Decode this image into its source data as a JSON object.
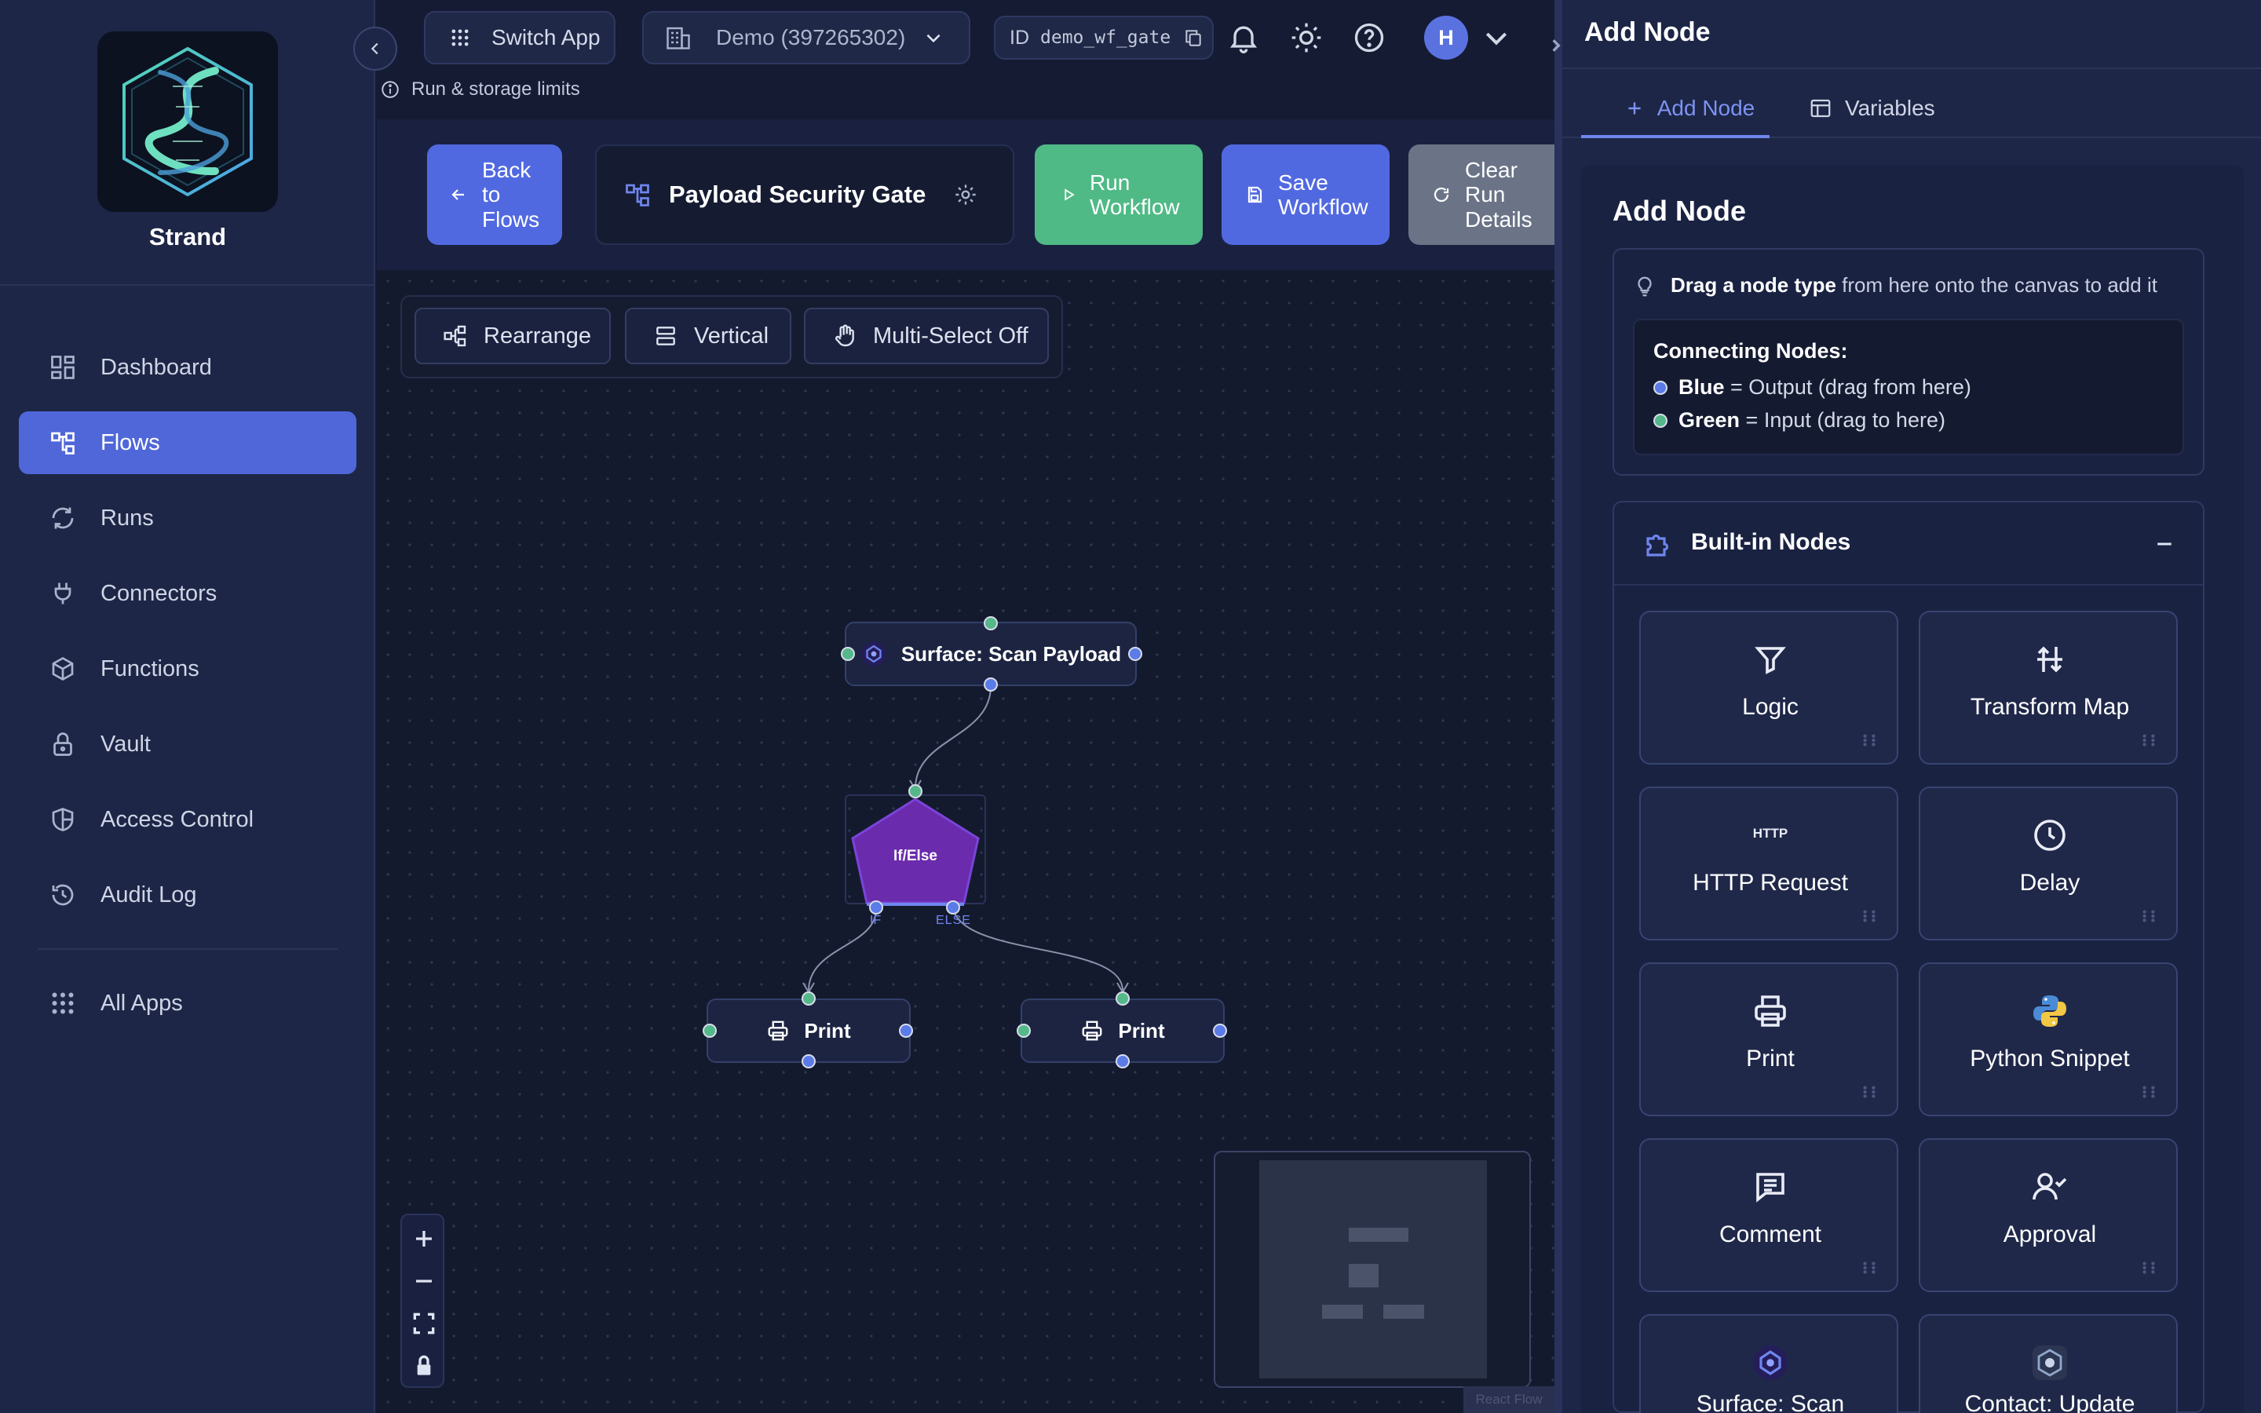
{
  "app": {
    "name": "Strand"
  },
  "sidebar": {
    "items": [
      {
        "label": "Dashboard",
        "icon": "dashboard-icon",
        "active": false
      },
      {
        "label": "Flows",
        "icon": "flows-icon",
        "active": true
      },
      {
        "label": "Runs",
        "icon": "runs-icon",
        "active": false
      },
      {
        "label": "Connectors",
        "icon": "plug-icon",
        "active": false
      },
      {
        "label": "Functions",
        "icon": "cube-icon",
        "active": false
      },
      {
        "label": "Vault",
        "icon": "lock-icon",
        "active": false
      },
      {
        "label": "Access Control",
        "icon": "shield-icon",
        "active": false
      },
      {
        "label": "Audit Log",
        "icon": "history-icon",
        "active": false
      }
    ],
    "all_apps": "All Apps"
  },
  "topbar": {
    "switch_app": "Switch App",
    "org": "Demo (397265302)",
    "id_prefix": "ID",
    "id_value": "demo_wf_gate",
    "avatar_initial": "H",
    "limits": "Run & storage limits"
  },
  "toolbar": {
    "back": "Back to Flows",
    "flow_name": "Payload Security Gate",
    "run": "Run Workflow",
    "save": "Save Workflow",
    "clear": "Clear Run Details"
  },
  "canvas": {
    "tools": [
      "Rearrange",
      "Vertical",
      "Multi-Select Off"
    ],
    "nodes": {
      "scan": "Surface: Scan Payload",
      "ifelse": "If/Else",
      "if_label": "IF",
      "else_label": "ELSE",
      "print_left": "Print",
      "print_right": "Print"
    },
    "attribution": "React Flow"
  },
  "panel": {
    "header": "Add Node",
    "tabs": [
      "Add Node",
      "Variables"
    ],
    "section_title": "Add Node",
    "hint_bold": "Drag a node type",
    "hint_rest": " from here onto the canvas to add it",
    "connecting_title": "Connecting Nodes:",
    "blue_label": "Blue",
    "blue_desc": " = Output (drag from here)",
    "green_label": "Green",
    "green_desc": " = Input (drag to here)",
    "builtin_title": "Built-in Nodes",
    "cards": [
      "Logic",
      "Transform Map",
      "HTTP Request",
      "Delay",
      "Print",
      "Python Snippet",
      "Comment",
      "Approval",
      "Surface: Scan",
      "Contact: Update"
    ],
    "http_badge": "HTTP"
  },
  "colors": {
    "accent": "#5169e0",
    "run_green": "#4fba86",
    "output_blue": "#5b7be8",
    "input_green": "#55b88a",
    "ifelse_purple": "#6a2bad"
  }
}
